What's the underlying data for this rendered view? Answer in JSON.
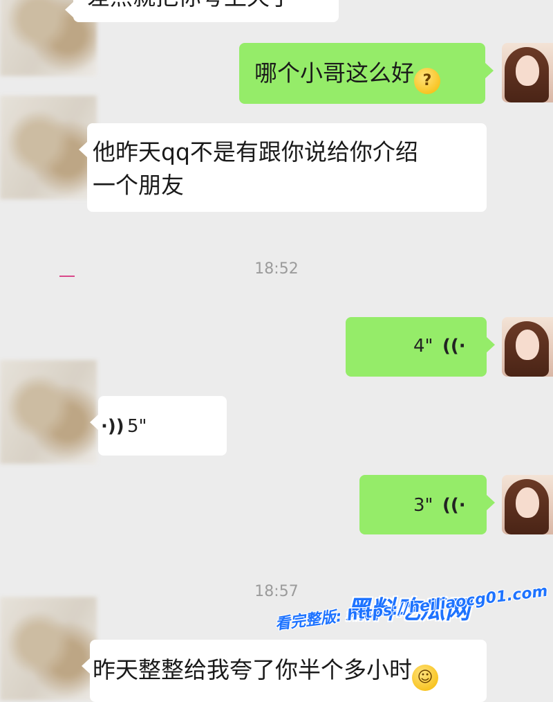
{
  "messages": {
    "m0_text": "差点就把你夸上天了",
    "m1_text": "哪个小哥这么好",
    "m2_text": "他昨天qq不是有跟你说给你介绍\n一个朋友",
    "m4_duration": "4\"",
    "m5_duration": "5\"",
    "m6_duration": "3\"",
    "m8_text": "昨天整整给我夸了你半个多小时"
  },
  "timestamps": {
    "t1": "18:52",
    "t2": "18:57"
  },
  "icons": {
    "voice_out": "voice-wave-left-icon",
    "voice_in": "voice-wave-right-icon",
    "emoji_1": "thinking-face-emoji",
    "emoji_2": "grinning-face-emoji"
  },
  "watermark": {
    "site_name": "黑料吃瓜网",
    "url_text": "看完整版: https://heiliaocg01.com"
  },
  "colors": {
    "outgoing_bubble": "#95ec69",
    "incoming_bubble": "#ffffff",
    "background": "#ececec",
    "watermark": "#1e73ff"
  }
}
